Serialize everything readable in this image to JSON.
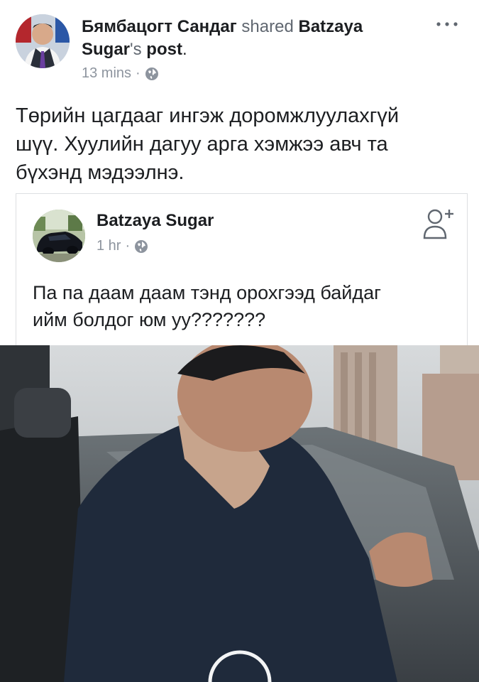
{
  "post": {
    "sharer_name": "Бямбацогт Сандаг",
    "shared_verb": "shared",
    "original_owner": "Batzaya Sugar",
    "possessive": "'s",
    "object": "post",
    "period": ".",
    "time": "13 mins",
    "separator": "·",
    "audience_icon": "globe-icon",
    "more_icon": "more-options-icon",
    "text_line1": "Төрийн цагдааг ингэж доромжлуулахгүй",
    "text_line2": "шүү. Хуулийн дагуу арга хэмжээ авч та",
    "text_line3": "бүхэнд мэдээлнэ."
  },
  "shared_post": {
    "author": "Batzaya Sugar",
    "time": "1 hr",
    "separator": "·",
    "audience_icon": "globe-icon",
    "add_friend_icon": "add-friend-icon",
    "text_line1": "Па па даам даам тэнд орохгээд байдаг",
    "text_line2": "ийм болдог юм уу???????"
  },
  "colors": {
    "text_primary": "#1c1e21",
    "text_secondary": "#8d949e",
    "border": "#dddfe2"
  }
}
